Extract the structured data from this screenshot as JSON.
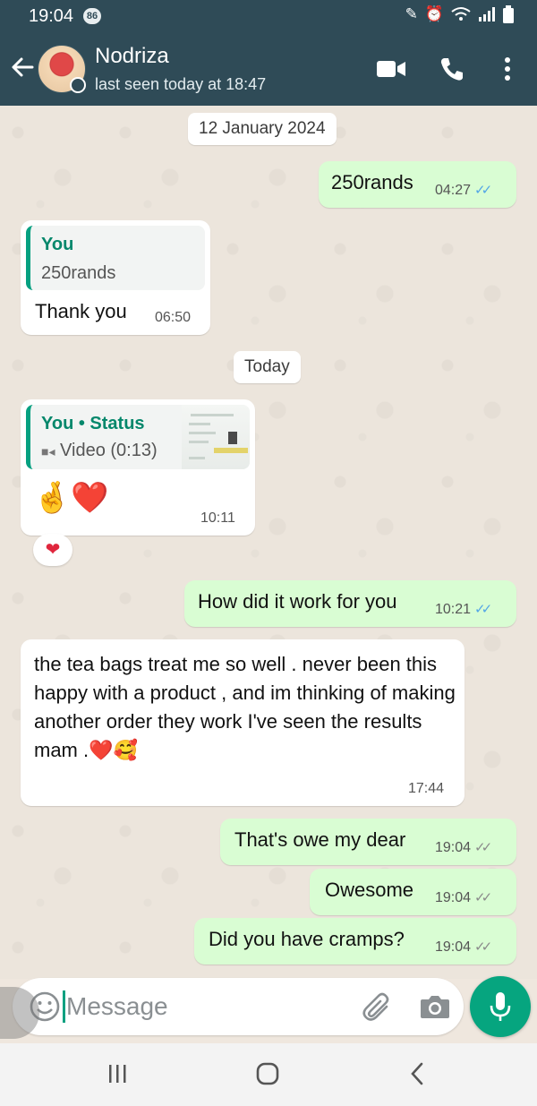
{
  "status_bar": {
    "time": "19:04",
    "badge": "86"
  },
  "header": {
    "name": "Nodriza",
    "last_seen": "last seen today at 18:47"
  },
  "chips": {
    "date1": "12 January 2024",
    "date2": "Today"
  },
  "messages": [
    {
      "text": "250rands",
      "time": "04:27",
      "ticks": "✓✓"
    },
    {
      "quote_author": "You",
      "quote_text": "250rands",
      "text": "Thank you",
      "time": "06:50"
    },
    {
      "quote_author": "You • Status",
      "quote_text": "Video (0:13)",
      "text": "🤞❤️",
      "time": "10:11",
      "reaction": "❤"
    },
    {
      "text": "How did it work for you",
      "time": "10:21",
      "ticks": "✓✓"
    },
    {
      "text": "the tea bags treat me so well  . never been this happy with a product , and im thinking of making another order they work I've seen the results mam .❤️🥰",
      "time": "17:44"
    },
    {
      "text": "That's owe my dear",
      "time": "19:04",
      "ticks": "✓✓"
    },
    {
      "text": "Owesome",
      "time": "19:04",
      "ticks": "✓✓"
    },
    {
      "text": "Did you have cramps?",
      "time": "19:04",
      "ticks": "✓✓"
    }
  ],
  "composer": {
    "placeholder": "Message"
  },
  "icons": [
    "back-arrow-icon",
    "video-call-icon",
    "phone-icon",
    "more-menu-icon",
    "emoji-icon",
    "attach-icon",
    "camera-icon",
    "mic-icon"
  ],
  "colors": {
    "header": "#2f4b57",
    "outgoing": "#d9fdd3",
    "incoming": "#ffffff",
    "accent": "#06a57f",
    "read_tick": "#53a6e6"
  }
}
